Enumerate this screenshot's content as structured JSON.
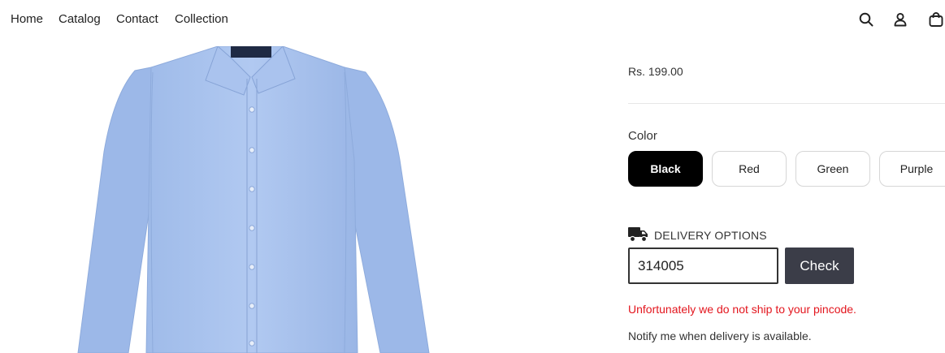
{
  "nav": {
    "items": [
      "Home",
      "Catalog",
      "Contact",
      "Collection"
    ]
  },
  "header_icons": [
    "search-icon",
    "account-icon",
    "cart-icon"
  ],
  "product": {
    "price": "Rs. 199.00",
    "color_label": "Color",
    "colors": [
      "Black",
      "Red",
      "Green",
      "Purple"
    ],
    "selected_color": "Black"
  },
  "delivery": {
    "label": "DELIVERY OPTIONS",
    "icon": "truck-icon",
    "pincode_value": "314005",
    "check_label": "Check",
    "error_message": "Unfortunately we do not ship to your pincode.",
    "notify_message": "Notify me when delivery is available."
  },
  "colors": {
    "shirt": "#a9c4ee",
    "selected_swatch": "#000000",
    "check_button": "#3b3d48",
    "error": "#e3151d"
  }
}
